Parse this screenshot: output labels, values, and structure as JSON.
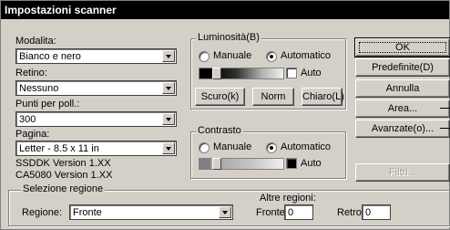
{
  "title": "Impostazioni scanner",
  "left": {
    "modalita_label": "Modalita:",
    "modalita_value": "Bianco e nero",
    "retino_label": "Retino:",
    "retino_value": "Nessuno",
    "punti_label": "Punti per poll.:",
    "punti_value": "300",
    "pagina_label": "Pagina:",
    "pagina_value": "Letter - 8.5 x 11 in",
    "ssddk_version": "SSDDK Version 1.XX",
    "ca_version": "CA5080 Version 1.XX"
  },
  "luminosita": {
    "title": "Luminosità(B)",
    "manuale": "Manuale",
    "automatico": "Automatico",
    "selected": "Automatico",
    "auto_label": "Auto",
    "scuro": "Scuro(k)",
    "norm": "Norm",
    "chiaro": "Chiaro(L)"
  },
  "contrasto": {
    "title": "Contrasto",
    "manuale": "Manuale",
    "automatico": "Automatico",
    "selected": "Automatico",
    "auto_label": "Auto"
  },
  "buttons": {
    "ok": "OK",
    "predefinite": "Predefinite(D)",
    "annulla": "Annulla",
    "area": "Area...",
    "avanzate": "Avanzate(o)...",
    "filtri": "Filtri..."
  },
  "regione": {
    "group_title": "Selezione regione",
    "regione_label": "Regione:",
    "regione_value": "Fronte",
    "altre_label": "Altre regioni:",
    "fronte_label": "Fronte:",
    "fronte_value": "0",
    "retro_label": "Retro:",
    "retro_value": "0"
  }
}
